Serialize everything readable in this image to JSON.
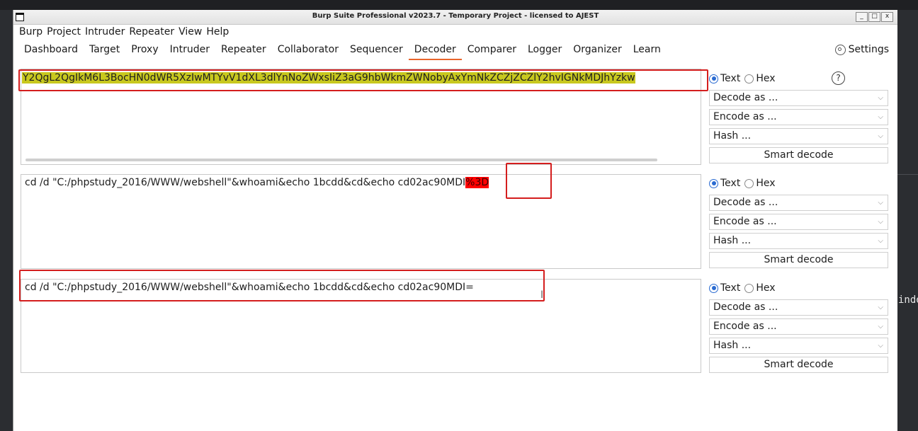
{
  "window": {
    "title": "Burp Suite Professional v2023.7 - Temporary Project - licensed to AJEST",
    "controls": [
      "_",
      "□",
      "x"
    ]
  },
  "menu": [
    "Burp",
    "Project",
    "Intruder",
    "Repeater",
    "View",
    "Help"
  ],
  "tabs": [
    "Dashboard",
    "Target",
    "Proxy",
    "Intruder",
    "Repeater",
    "Collaborator",
    "Sequencer",
    "Decoder",
    "Comparer",
    "Logger",
    "Organizer",
    "Learn"
  ],
  "active_tab": "Decoder",
  "settings_label": "Settings",
  "background_code": "indo",
  "decoder": {
    "panel1": {
      "text": "Y2QgL2QgIkM6L3BocHN0dWR5XzIwMTYvV1dXL3dlYnNoZWxsIiZ3aG9hbWkmZWNobyAxYmNkZCZjZCZlY2hvIGNkMDJhYzkw"
    },
    "panel2": {
      "text_main": "cd /d \"C:/phpstudy_2016/WWW/webshell\"&whoami&echo 1bcdd&cd&echo cd02ac90MDI",
      "text_highlight": "%3D"
    },
    "panel3": {
      "text": "cd /d \"C:/phpstudy_2016/WWW/webshell\"&whoami&echo 1bcdd&cd&echo cd02ac90MDI="
    },
    "controls": {
      "text_label": "Text",
      "hex_label": "Hex",
      "help": "?",
      "decode_as": "Decode as ...",
      "encode_as": "Encode as ...",
      "hash": "Hash ...",
      "smart_decode": "Smart decode"
    }
  },
  "colors": {
    "accent": "#e8652c",
    "highlight_yellow": "#c8c81e",
    "highlight_red": "#ff0000",
    "annotation_red": "#d41e1e"
  }
}
